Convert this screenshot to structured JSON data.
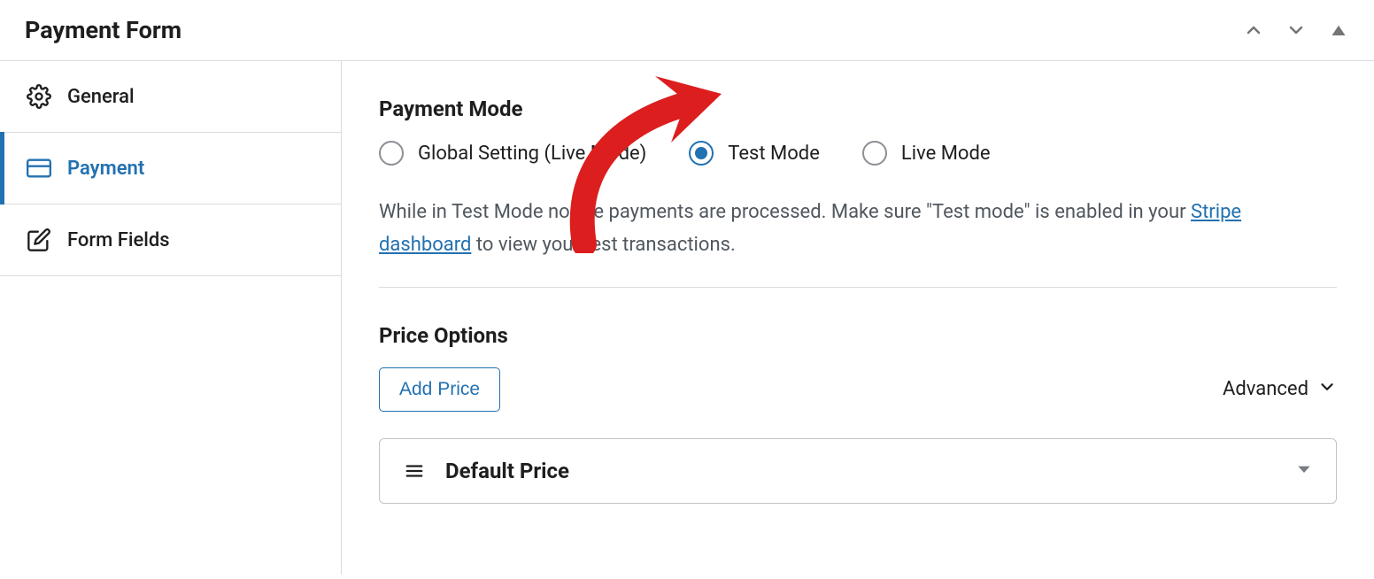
{
  "panel": {
    "title": "Payment Form"
  },
  "sidebar": {
    "items": [
      {
        "label": "General"
      },
      {
        "label": "Payment"
      },
      {
        "label": "Form Fields"
      }
    ]
  },
  "payment_mode": {
    "title": "Payment Mode",
    "options": [
      {
        "label": "Global Setting (Live Mode)",
        "selected": false
      },
      {
        "label": "Test Mode",
        "selected": true
      },
      {
        "label": "Live Mode",
        "selected": false
      }
    ],
    "helper_before": "While in Test Mode no live payments are processed. Make sure \"Test mode\" is enabled in your ",
    "helper_link": "Stripe dashboard",
    "helper_after": " to view your test transactions."
  },
  "price_options": {
    "title": "Price Options",
    "add_btn": "Add Price",
    "advanced": "Advanced",
    "items": [
      {
        "label": "Default Price"
      }
    ]
  }
}
